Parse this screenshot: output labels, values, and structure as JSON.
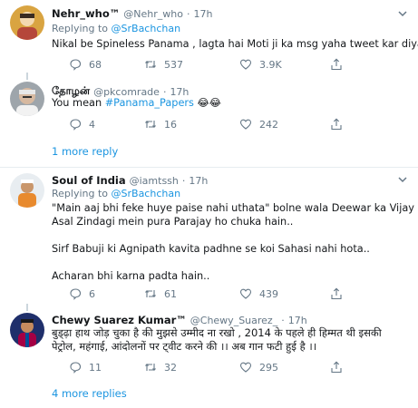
{
  "tweets": [
    {
      "name": "Nehr_who™",
      "handle": "@Nehr_who",
      "dot": "·",
      "time": "17h",
      "replying_prefix": "Replying to ",
      "replying_to": "@SrBachchan",
      "text_lines": [
        "Nikal be Spineless Panama , lagta hai Moti ji ka msg yaha tweet kar diya"
      ],
      "replies": "68",
      "retweets": "537",
      "likes": "3.9K"
    },
    {
      "name": "தோழன்",
      "handle": "@pkcomrade",
      "dot": "·",
      "time": "17h",
      "text_prefix": "You mean ",
      "hashtag": "#Panama_Papers",
      "emoji": "😂😂",
      "replies": "4",
      "retweets": "16",
      "likes": "242",
      "more_replies": "1 more reply"
    },
    {
      "name": "Soul of India",
      "handle": "@iamtssh",
      "dot": "·",
      "time": "17h",
      "replying_prefix": "Replying to ",
      "replying_to": "@SrBachchan",
      "text_lines": [
        "\"Main aaj bhi feke huye paise nahi uthata\" bolne wala Deewar ka Vijay aaj",
        "Asal Zindagi mein pura Parajay ho chuka hain..",
        "",
        "Sirf Babuji ki Agnipath kavita padhne se koi Sahasi nahi hota..",
        "",
        "Acharan bhi karna padta hain.."
      ],
      "replies": "6",
      "retweets": "61",
      "likes": "439"
    },
    {
      "name": "Chewy Suarez Kumar™",
      "handle": "@Chewy_Suarez_",
      "dot": "·",
      "time": "17h",
      "text_lines": [
        "बुड्ढ़ा हाथ जोड़ चुका है की मुझसे उम्मीद ना रखो , 2014 के पहले ही हिम्मत थी इसकी",
        "पेट्रोल, महंगाई, आंदोलनों पर ट्वीट करने की ।। अब गान फटी हुई है ।।"
      ],
      "replies": "11",
      "retweets": "32",
      "likes": "295",
      "more_replies": "4 more replies"
    }
  ],
  "colors": {
    "accent": "#1b95e0",
    "secondary_text": "#657786",
    "divider": "#e6ecf0"
  }
}
